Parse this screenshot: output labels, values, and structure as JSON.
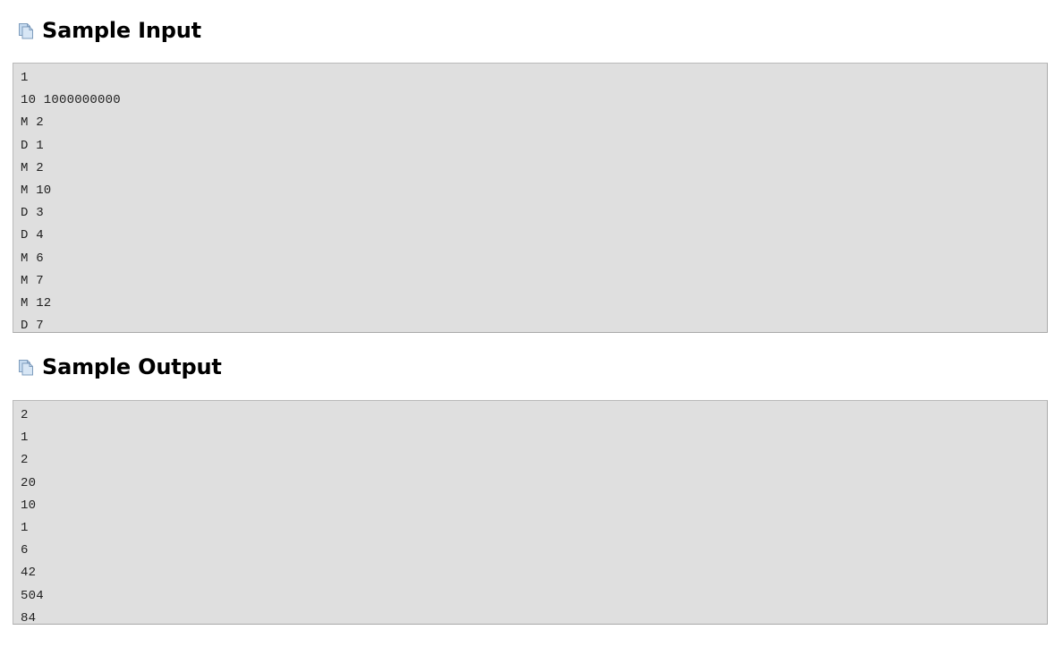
{
  "page": {
    "background_color": "#ffffff",
    "text_color": "#000000"
  },
  "sections": [
    {
      "id": "sample-input",
      "heading": "Sample Input",
      "icon": "copy-pages-icon",
      "box": {
        "background_color": "#dfdfdf",
        "border_color": "#b9b9b9",
        "text_color": "#222222",
        "lines": [
          "1",
          "10 1000000000",
          "M 2",
          "D 1",
          "M 2",
          "M 10",
          "D 3",
          "D 4",
          "M 6",
          "M 7",
          "M 12",
          "D 7"
        ]
      }
    },
    {
      "id": "sample-output",
      "heading": "Sample Output",
      "icon": "copy-pages-icon",
      "box": {
        "background_color": "#dfdfdf",
        "border_color": "#b9b9b9",
        "text_color": "#222222",
        "lines": [
          "2",
          "1",
          "2",
          "20",
          "10",
          "1",
          "6",
          "42",
          "504",
          "84"
        ]
      }
    }
  ],
  "icon_colors": {
    "fill": "#d7e6f5",
    "fill_back": "#c6dbf0",
    "stroke": "#7e9cbd"
  }
}
